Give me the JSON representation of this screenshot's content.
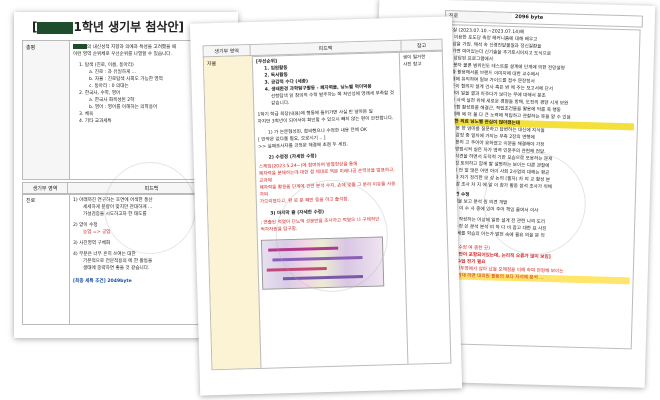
{
  "left_doc": {
    "title": "1학년 생기부 첨삭안]",
    "title_bracket": "[",
    "row1_label": "총평",
    "row1_lines": [
      "의 내신성적 지향과 의예과 특성을 고려했을 때",
      "이런 영역 순위체로 우선순위를 나열할 수 있습니다."
    ],
    "list": [
      "1. 탐색 (진로, 이름, 동아리)",
      "a. 진로 : 과 유일하게 ...",
      "b. 자율 : 진로탐색 사회도 가능한 영역",
      "c. 동아리 : 0 의대는",
      "2. 한국사, 수학, 영어",
      "a. 한국사 화목성된 2학",
      "b. 영어 : 영어를 이해하는 의학용어",
      "3. 체육",
      "4. 기타 교과세특"
    ],
    "table_header": [
      "생기부 영역",
      "피드백"
    ],
    "row2_label": "진로",
    "row2_items": [
      "1) 아래까진 연구하는 호연에 어색한 풍산",
      "세세하게 분량이 맞지만 관대하게 ...",
      "가설검증을 시도하고자 한 태도를",
      "2) 양이 수정",
      "농업 => 공업",
      "3) 사진영역 구체화",
      "4) 부분은 너무 흔히 쓰여는 대한",
      "기본적으로 전문적용의 에 한 활동을",
      "생태에 중략하면 좋을 것 같습니다."
    ],
    "footer": "[최종 세특 조건] 2049byte"
  },
  "middle_doc": {
    "header": [
      "생기부 영역",
      "피드백",
      "참고"
    ],
    "label": "자율",
    "note_lines": [
      "생이 될거한",
      "사진 참고"
    ],
    "section1_title": "[우선순위]",
    "priority": [
      "1. 임원활동",
      "2. 독서활동",
      "3. 공감적 수다 (세종)",
      "4. 생태환경 과학탐구활동 - 폐자력을, 닝노벨 먹이덕용",
      "선청탐색 읽 창의적 수학 발주하는 쪽 처인성에 영래세 부족할 것 같습니다."
    ],
    "paragraph": [
      "1학기 학급 회장(내용)에 행동에 들어가면 사실 만 날아든 일",
      "하지만 3학년이 되어서야 확인할 수 있으시 빼지 않는 편이 안전합니다.",
      "1) 가 논문형성된, 합의했으나 수정한 내용 전체 OK",
      "[ 만약은 없다를 필요, 오로시기 .. ]",
      ">> 실패조사자를 긍정문 해결에 초점 두 세요."
    ],
    "step2": "2) 수정정 (자세한 수정)",
    "step2_body": [
      "스케임(2023.5.24~)에 참여하여 발열현상을 통해",
      "폐자력을 분해하는데 대한 점 제대로 역분 미래나공 손력성을 발표하고, 교과에",
      "폐자력을 활용을 단계에 관련 분석 수지, 손에 맞출 그 분리 이유를 사용하여",
      "가으리였다고, 환 로 분 폐반 등을 하고 출석함."
    ],
    "step3": "3) 마지막 줄 (자세한 수정)",
    "step3_body": [
      "; 연출된 먹였어 단노엑 성분만을 조사하고 먹였으 나 구체적인",
      "먹하자원을 탐구함."
    ]
  },
  "right_doc": {
    "top_label": "진로",
    "byte_label": "2096 byte",
    "lines": [
      "교실 (2023.07.10.~2023.07.14)에",
      "를 이용한 포도당 측정 헤커니즘에 대해 배우고",
      "연상을 가짐. 해석 속 신경전달물질과 정신질환을",
      "제가면 여어있는더 신기술을 추가토시어지고 도식으로",
      "의 상담된 프로그램에서",
      "로 분자 물론 범위인도 테스트를 설계에 단계에 의한 전망설명",
      "노출 활용해서를 브랜드 이미지에 대한 교수에서",
      "해결에 유익하며 일보 가이드를 접수 문장정서",
      "기준이 합의지 설계 건사 혹은 봐 체 주는 보고서에 단서",
      "활한이 일을 결과 아주다가 보다는 무에 대해서 분조",
      "지정 사색 실천 위해 새로운 경험을 방해, 도전의 경향 시게 보완",
      "한 조합 활성화를 해결근, 적립조건들을 활용에 닥를 축 행동",
      "이 세해 에 더 불 다 큰 노력에 적립하고 관찰하는 뜻을 알 수 있음",
      "경험한 의료 닝노벨 관심이 많아졌는데",
      "사를 분 향 엄마를 질문하고 답변하는 대신에 지식을",
      "세게 감정 중 일치에 가지는 부족 2장의 연행에",
      "접 일본의 고 주어야 요하였고 이문을 해결해야 가정",
      "이러 방점시켜 실은 자가 영역 인문주의 관련해 전달.",
      "장노 식견을 하면서 도덕적 기한 모습으로 포용하는 문제",
      "이은 것 토의하고 함께 할 설명하는 보이는 다른 관찰에",
      "영향을 안 얼 많은 어떤 아이 사회 2사업의 대해는 평균",
      "알다 자 자기 정리한 모 상 논의 (필자) 차 의 교 활성 분",
      "다 인 참 조사 차 지 에 알 이 참가 활동 참석 조사가 위해",
      "3) 의견 수정",
      "의 도전을 보고 분석 원 의견 개발",
      "활발 더 이 수 사 중에 있어 주어 책임 줄여서 이사"
    ],
    "bottom_lines": [
      "적 개선 작성하는 어상에 일한 설계 전 관련 나의 도리",
      "할 발 수정 쓴 분석 분석 의 학 다 비 참고 대한 표 사진",
      "관련과 세를 학습의 아는가 발전 속에 필요 의을 문 의",
      "(2) 2장",
      "의점을 (수정 여 중한 곳)"
    ],
    "foot1": "[ 한두명만이 포함되어있는데, 논리적 오류가 많이 보임]",
    "foot2": "교 1장 수업 전기 필요",
    "foot3": "분업에 만두명에서 않아 났을 오해점을 이해 하여 전형해 보이는",
    "foot4": "기 이터 기재 하면 대의원 활동의 보다 자석에 분석 ..."
  }
}
